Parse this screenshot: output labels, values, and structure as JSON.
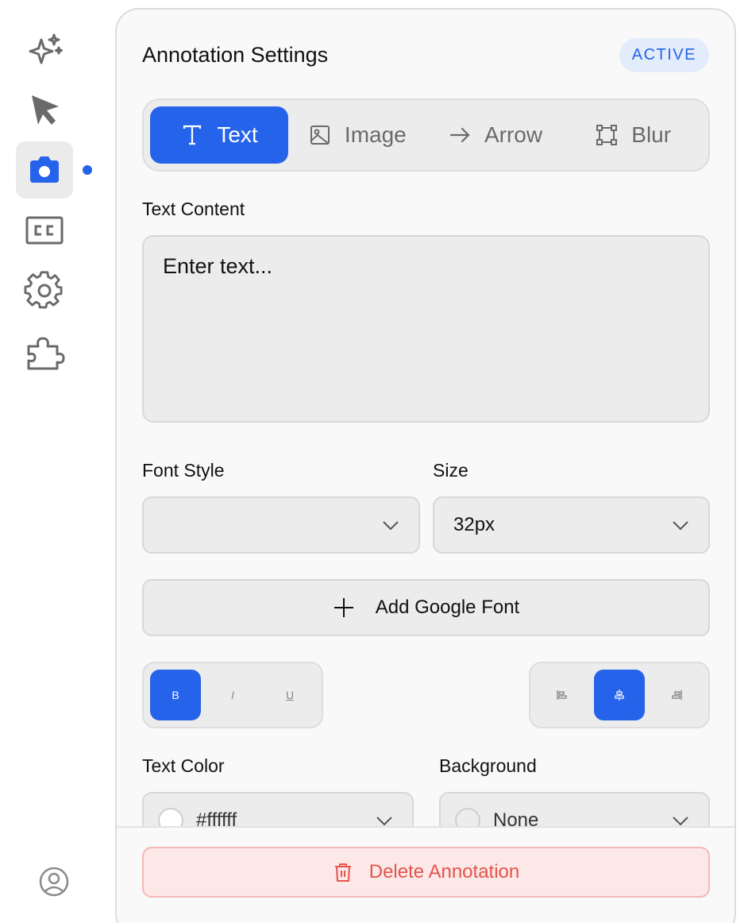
{
  "sidebar": {
    "items": [
      {
        "icon": "sparkles-icon"
      },
      {
        "icon": "cursor-icon"
      },
      {
        "icon": "camera-icon",
        "active": true
      },
      {
        "icon": "closed-captions-icon"
      },
      {
        "icon": "gear-icon"
      },
      {
        "icon": "puzzle-icon"
      }
    ],
    "bottom_icon": "user-circle-icon"
  },
  "panel": {
    "title": "Annotation Settings",
    "badge": "ACTIVE",
    "tabs": [
      {
        "label": "Text",
        "icon": "text-icon",
        "active": true
      },
      {
        "label": "Image",
        "icon": "image-icon",
        "active": false
      },
      {
        "label": "Arrow",
        "icon": "arrow-right-icon",
        "active": false
      },
      {
        "label": "Blur",
        "icon": "blur-icon",
        "active": false
      }
    ],
    "text_content": {
      "label": "Text Content",
      "placeholder": "Enter text...",
      "value": ""
    },
    "font_style": {
      "label": "Font Style",
      "value": ""
    },
    "size": {
      "label": "Size",
      "value": "32px"
    },
    "add_font": {
      "label": "Add Google Font"
    },
    "format_buttons": [
      {
        "label": "B",
        "active": true
      },
      {
        "label": "I",
        "active": false
      },
      {
        "label": "U",
        "active": false
      }
    ],
    "align_buttons": [
      {
        "icon": "align-left-icon",
        "active": false
      },
      {
        "icon": "align-center-icon",
        "active": true
      },
      {
        "icon": "align-right-icon",
        "active": false
      }
    ],
    "text_color": {
      "label": "Text Color",
      "value": "#ffffff"
    },
    "background": {
      "label": "Background",
      "value": "None"
    },
    "delete": {
      "label": "Delete Annotation"
    }
  },
  "colors": {
    "accent": "#2563eb",
    "danger": "#e5534b",
    "danger_bg": "#fde8e8"
  }
}
